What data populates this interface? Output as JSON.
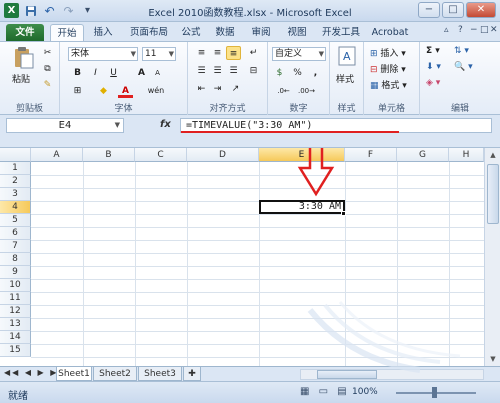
{
  "window": {
    "title": "Excel 2010函数教程.xlsx - Microsoft Excel",
    "buttons": {
      "minimize": "−",
      "maximize": "□",
      "close": "✕"
    }
  },
  "qat": {
    "logo": "X",
    "save": "💾",
    "undo": "↶",
    "redo": "↷",
    "customize": "▾"
  },
  "tabs": [
    {
      "label": "文件"
    },
    {
      "label": "开始"
    },
    {
      "label": "插入"
    },
    {
      "label": "页面布局"
    },
    {
      "label": "公式"
    },
    {
      "label": "数据"
    },
    {
      "label": "审阅"
    },
    {
      "label": "视图"
    },
    {
      "label": "开发工具"
    },
    {
      "label": "Acrobat"
    }
  ],
  "ribbon": {
    "clipboard": {
      "label": "剪贴板",
      "paste": "粘贴"
    },
    "font": {
      "label": "字体",
      "name": "宋体",
      "size": "11",
      "bold": "B",
      "italic": "I",
      "underline": "U",
      "grow": "A",
      "shrink": "A",
      "wen": "wén",
      "color_a": "A"
    },
    "alignment": {
      "label": "对齐方式"
    },
    "number": {
      "label": "数字",
      "format": "自定义",
      "percent": "%",
      "comma": ",",
      "currency": "$"
    },
    "styles": {
      "label": "样式",
      "button": "样式"
    },
    "cells": {
      "label": "单元格",
      "insert": "插入",
      "delete": "删除",
      "format": "格式"
    },
    "editing": {
      "label": "编辑",
      "sum": "Σ"
    }
  },
  "formula_bar": {
    "name_box": "E4",
    "fx": "fx",
    "formula": "=TIMEVALUE(\"3:30 AM\")"
  },
  "columns": [
    "A",
    "B",
    "C",
    "D",
    "E",
    "F",
    "G",
    "H"
  ],
  "selected_column": "E",
  "rows": [
    "1",
    "2",
    "3",
    "4",
    "5",
    "6",
    "7",
    "8",
    "9",
    "10",
    "11",
    "12",
    "13",
    "14",
    "15"
  ],
  "selected_row": "4",
  "active_cell": {
    "ref": "E4",
    "value": "3:30 AM"
  },
  "sheets": [
    "Sheet1",
    "Sheet2",
    "Sheet3"
  ],
  "active_sheet": "Sheet1",
  "status": {
    "ready": "就绪",
    "zoom": "100%"
  },
  "accent": {
    "file_tab": "#2a7d3a",
    "annotation": "#e02020",
    "selection": "#f6c95a"
  }
}
